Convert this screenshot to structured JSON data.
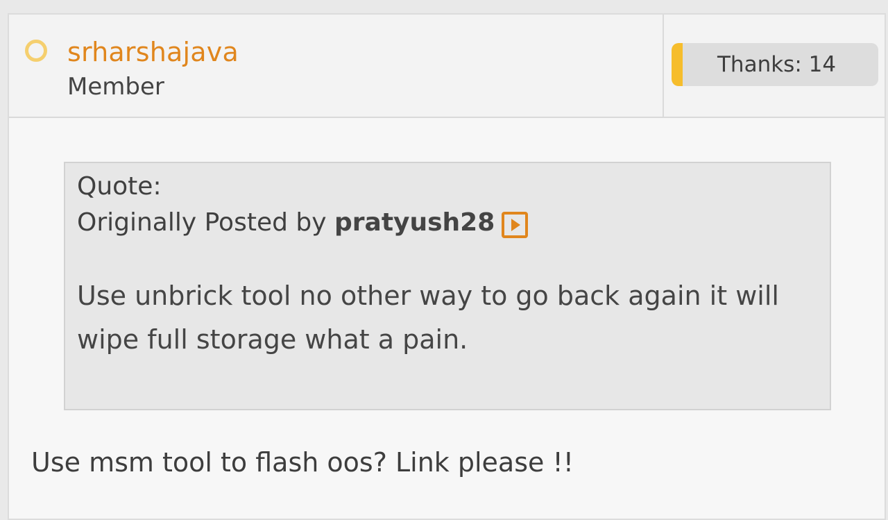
{
  "post": {
    "author": {
      "username": "srharshajava",
      "title": "Member",
      "status_color": "#f5cf6e"
    },
    "thanks": {
      "label": "Thanks: 14"
    },
    "quote": {
      "label": "Quote:",
      "prefix": "Originally Posted by ",
      "author": "pratyush28",
      "view_icon": "view-post-icon",
      "message": "Use unbrick tool no other way to go back again it will wipe full storage what a pain."
    },
    "message": "Use msm tool to flash oos? Link please !!"
  },
  "colors": {
    "accent": "#e0861d",
    "thanks_accent": "#f6bd2c"
  }
}
